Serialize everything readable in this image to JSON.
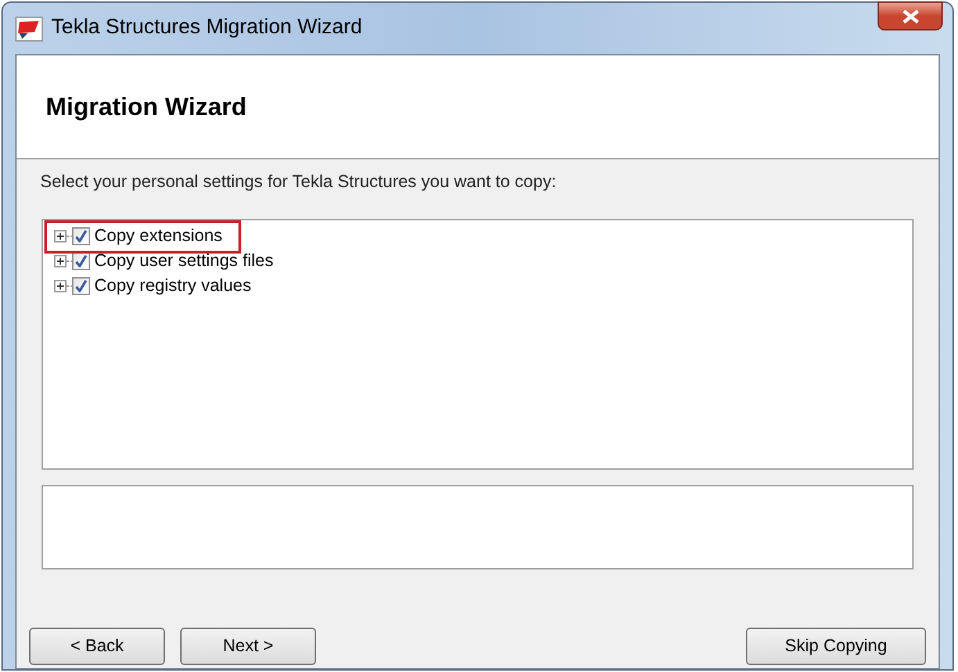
{
  "window": {
    "title": "Tekla Structures Migration Wizard"
  },
  "header": {
    "title": "Migration Wizard"
  },
  "instruction": "Select your personal settings for Tekla Structures you want to copy:",
  "tree": {
    "items": [
      {
        "label": "Copy extensions",
        "checked": true,
        "expanded": false,
        "highlighted": true
      },
      {
        "label": "Copy user settings files",
        "checked": true,
        "expanded": false,
        "highlighted": false
      },
      {
        "label": "Copy registry values",
        "checked": true,
        "expanded": false,
        "highlighted": false
      }
    ]
  },
  "buttons": [
    {
      "label": "< Back",
      "kind": "left"
    },
    {
      "label": "Next >",
      "kind": "left"
    },
    {
      "label": "Skip Copying",
      "kind": "right"
    }
  ]
}
